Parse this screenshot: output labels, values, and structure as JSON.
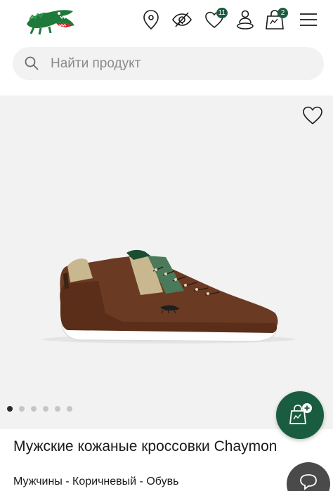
{
  "header": {
    "logo": "lacoste-crocodile-logo",
    "icons": [
      "location-pin-icon",
      "accessibility-eye-icon",
      "heart-icon",
      "user-location-icon",
      "shopping-bag-icon",
      "menu-icon"
    ],
    "wishlist_count": "11",
    "cart_count": "2"
  },
  "search": {
    "placeholder": "Найти продукт",
    "icon": "search-icon"
  },
  "gallery": {
    "total_images": 6,
    "active_index": 0
  },
  "product": {
    "title": "Мужские кожаные кроссовки Chaymon",
    "breadcrumb": "Мужчины - Коричневый - Обувь"
  },
  "colors": {
    "brand_green": "#1a5c3f",
    "gallery_bg": "#f2f2f2",
    "shoe_brown": "#6b3a22",
    "stripe_green": "#4b7a5a",
    "stripe_tan": "#c9b88f"
  }
}
